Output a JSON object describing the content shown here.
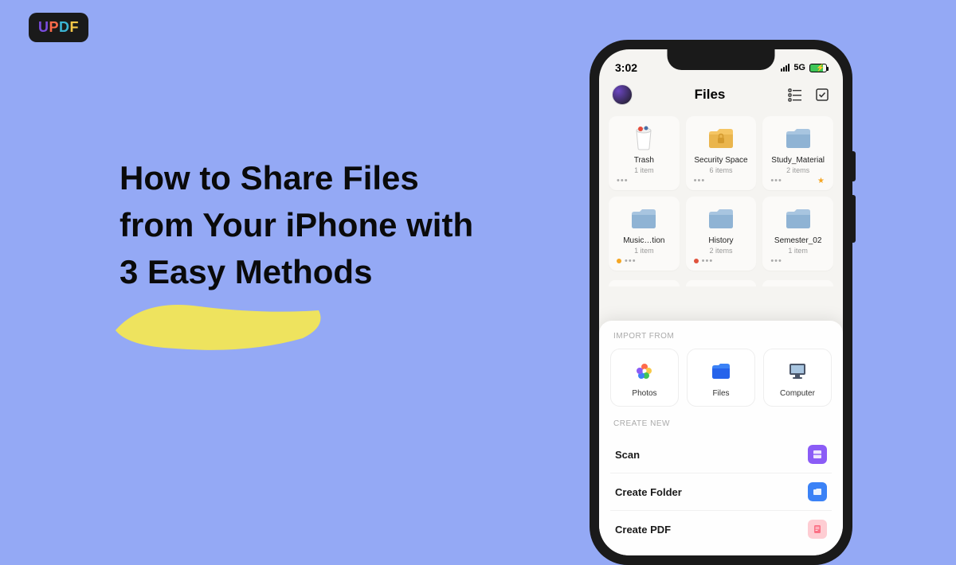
{
  "brand": {
    "u": "U",
    "p": "P",
    "d": "D",
    "f": "F"
  },
  "headline": "How to Share Files from Your iPhone with 3 Easy Methods",
  "status": {
    "time": "3:02",
    "network": "5G"
  },
  "app": {
    "title": "Files"
  },
  "folders": [
    {
      "name": "Trash",
      "meta": "1 item",
      "type": "trash"
    },
    {
      "name": "Security Space",
      "meta": "6 items",
      "type": "secure"
    },
    {
      "name": "Study_Material",
      "meta": "2 items",
      "type": "folder",
      "star": true
    },
    {
      "name": "Music…tion",
      "meta": "1 item",
      "type": "folder",
      "tag": "#f5a623"
    },
    {
      "name": "History",
      "meta": "2 items",
      "type": "folder",
      "tag": "#e0533d"
    },
    {
      "name": "Semester_02",
      "meta": "1 item",
      "type": "folder"
    }
  ],
  "sheet": {
    "import_label": "IMPORT FROM",
    "imports": [
      {
        "label": "Photos"
      },
      {
        "label": "Files"
      },
      {
        "label": "Computer"
      }
    ],
    "create_label": "CREATE NEW",
    "creates": [
      {
        "label": "Scan",
        "color": "#8b5cf6"
      },
      {
        "label": "Create Folder",
        "color": "#3b82f6"
      },
      {
        "label": "Create PDF",
        "color": "#fb7185"
      }
    ]
  }
}
